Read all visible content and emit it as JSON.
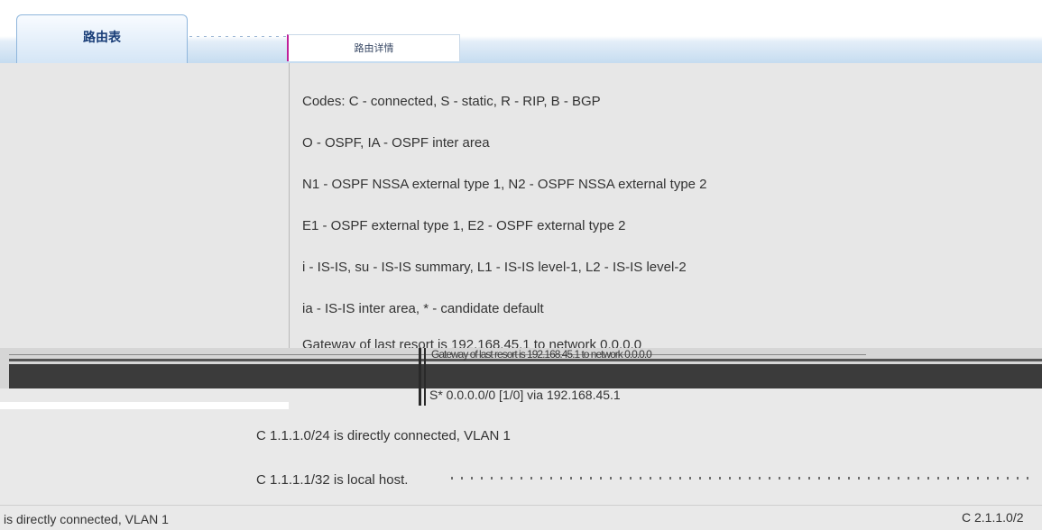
{
  "tabs": {
    "route_table": "路由表",
    "second_tab": "路由详情"
  },
  "route_codes": [
    "Codes: C - connected, S - static, R - RIP, B - BGP",
    "O - OSPF, IA - OSPF inter area",
    "N1 - OSPF NSSA external type 1, N2 - OSPF NSSA external type 2",
    "E1 - OSPF external type 1, E2 - OSPF external type 2",
    "i - IS-IS, su - IS-IS summary, L1 - IS-IS level-1, L2 - IS-IS level-2",
    "ia - IS-IS inter area, * - candidate default",
    "Gateway of last resort is 192.168.45.1 to network 0.0.0.0"
  ],
  "glitch_text": "Gateway of last resort is 192.168.45.1 to network 0.0.0.0",
  "routes": {
    "default_route": "S* 0.0.0.0/0 [1/0] via 192.168.45.1",
    "c_1_1_1_0": "C 1.1.1.0/24 is directly connected, VLAN 1",
    "c_1_1_1_1": "C 1.1.1.1/32 is local host.",
    "c_2_1_1_0_tail": "is directly connected, VLAN 1",
    "c_2_1_1_0_head": "C 2.1.1.0/2"
  }
}
